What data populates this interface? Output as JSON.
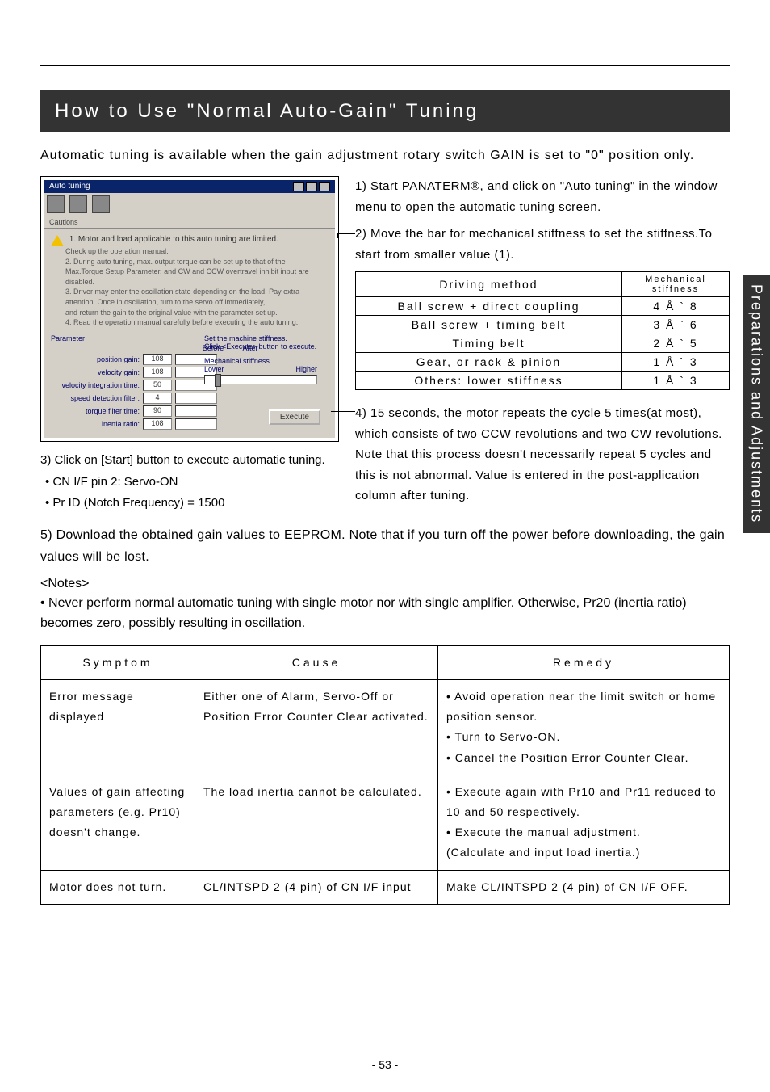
{
  "side_tab": "Preparations and Adjustments",
  "page_number": "- 53 -",
  "section_title": "How to Use \"Normal Auto-Gain\" Tuning",
  "intro": "Automatic tuning is available when the gain adjustment rotary switch GAIN is set to \"0\" position only.",
  "dialog": {
    "title": "Auto tuning",
    "caution_header": "Cautions",
    "warn1": "1. Motor and load applicable to this auto tuning are limited.",
    "warn1b": "Check up the operation manual.",
    "list": [
      "2. During auto tuning, max. output torque can be set up to that of the",
      "Max.Torque Setup Parameter, and CW and CCW overtravel inhibit input are disabled.",
      "3. Driver may enter the oscillation state depending on the load. Pay extra",
      "attention. Once in oscillation, turn to the servo off immediately,",
      "and return the gain to the original value with the parameter set up.",
      "4. Read the operation manual carefully before executing the auto tuning."
    ],
    "param_header": "Parameter",
    "before_header": "Before",
    "after_header": "After",
    "rows": [
      {
        "label": "position gain:",
        "before": "108"
      },
      {
        "label": "velocity gain:",
        "before": "108"
      },
      {
        "label": "velocity integration time:",
        "before": "50"
      },
      {
        "label": "speed detection filter:",
        "before": "4"
      },
      {
        "label": "torque filter time:",
        "before": "90"
      },
      {
        "label": "inertia ratio:",
        "before": "108"
      }
    ],
    "right_text1": "Set the machine stiffness.",
    "right_text2": "Click <Execute> button to execute.",
    "stiff_label": "Mechanical stiffness",
    "lower": "Lower",
    "higher": "Higher",
    "execute": "Execute"
  },
  "steps": {
    "s1": "1) Start PANATERM®, and click on \"Auto tuning\" in the window menu to open the automatic tuning screen.",
    "s2": "2) Move the bar for mechanical stiffness to set the stiffness.To start from smaller value (1).",
    "s4": "4) 15 seconds, the motor repeats the cycle 5 times(at most), which consists of two CCW revolutions and two CW revolutions. Note that this process doesn't necessarily repeat 5 cycles and this is not abnormal. Value is entered in the post-application column after tuning."
  },
  "mech_table": {
    "h1": "Driving method",
    "h2": "Mechanical stiffness",
    "rows": [
      {
        "a": "Ball screw + direct coupling",
        "b": "4 Å ` 8"
      },
      {
        "a": "Ball screw + timing belt",
        "b": "3 Å ` 6"
      },
      {
        "a": "Timing belt",
        "b": "2 Å ` 5"
      },
      {
        "a": "Gear, or rack & pinion",
        "b": "1 Å ` 3"
      },
      {
        "a": "Others: lower stiffness",
        "b": "1 Å ` 3"
      }
    ]
  },
  "left_steps": {
    "s3": "3) Click on [Start] button to execute automatic tuning.",
    "b1": "CN I/F pin 2: Servo-ON",
    "b2": "Pr ID (Notch Frequency) = 1500"
  },
  "step5": "5) Download the obtained gain values to EEPROM. Note that if you turn off the power before downloading, the gain values will be lost.",
  "notes_head": "<Notes>",
  "notes_body": "•  Never perform normal automatic tuning with single motor nor with single amplifier. Otherwise, Pr20 (inertia ratio) becomes zero, possibly resulting in oscillation.",
  "remedy_table": {
    "h1": "Symptom",
    "h2": "Cause",
    "h3": "Remedy",
    "rows": [
      {
        "s": "Error message displayed",
        "c": "Either one of Alarm, Servo-Off or Position Error Counter Clear activated.",
        "r": "• Avoid operation near the limit switch or home position sensor.\n• Turn to Servo-ON.\n• Cancel the Position Error Counter Clear."
      },
      {
        "s": "Values of gain affecting parameters (e.g. Pr10) doesn't change.",
        "c": "The load inertia cannot be calculated.",
        "r": "• Execute again with Pr10 and Pr11 reduced to 10 and 50 respectively.\n• Execute the manual adjustment.\n(Calculate and input load inertia.)"
      },
      {
        "s": "Motor does not turn.",
        "c": "CL/INTSPD 2 (4 pin) of CN I/F input",
        "r": "Make CL/INTSPD 2 (4 pin) of CN I/F OFF."
      }
    ]
  }
}
